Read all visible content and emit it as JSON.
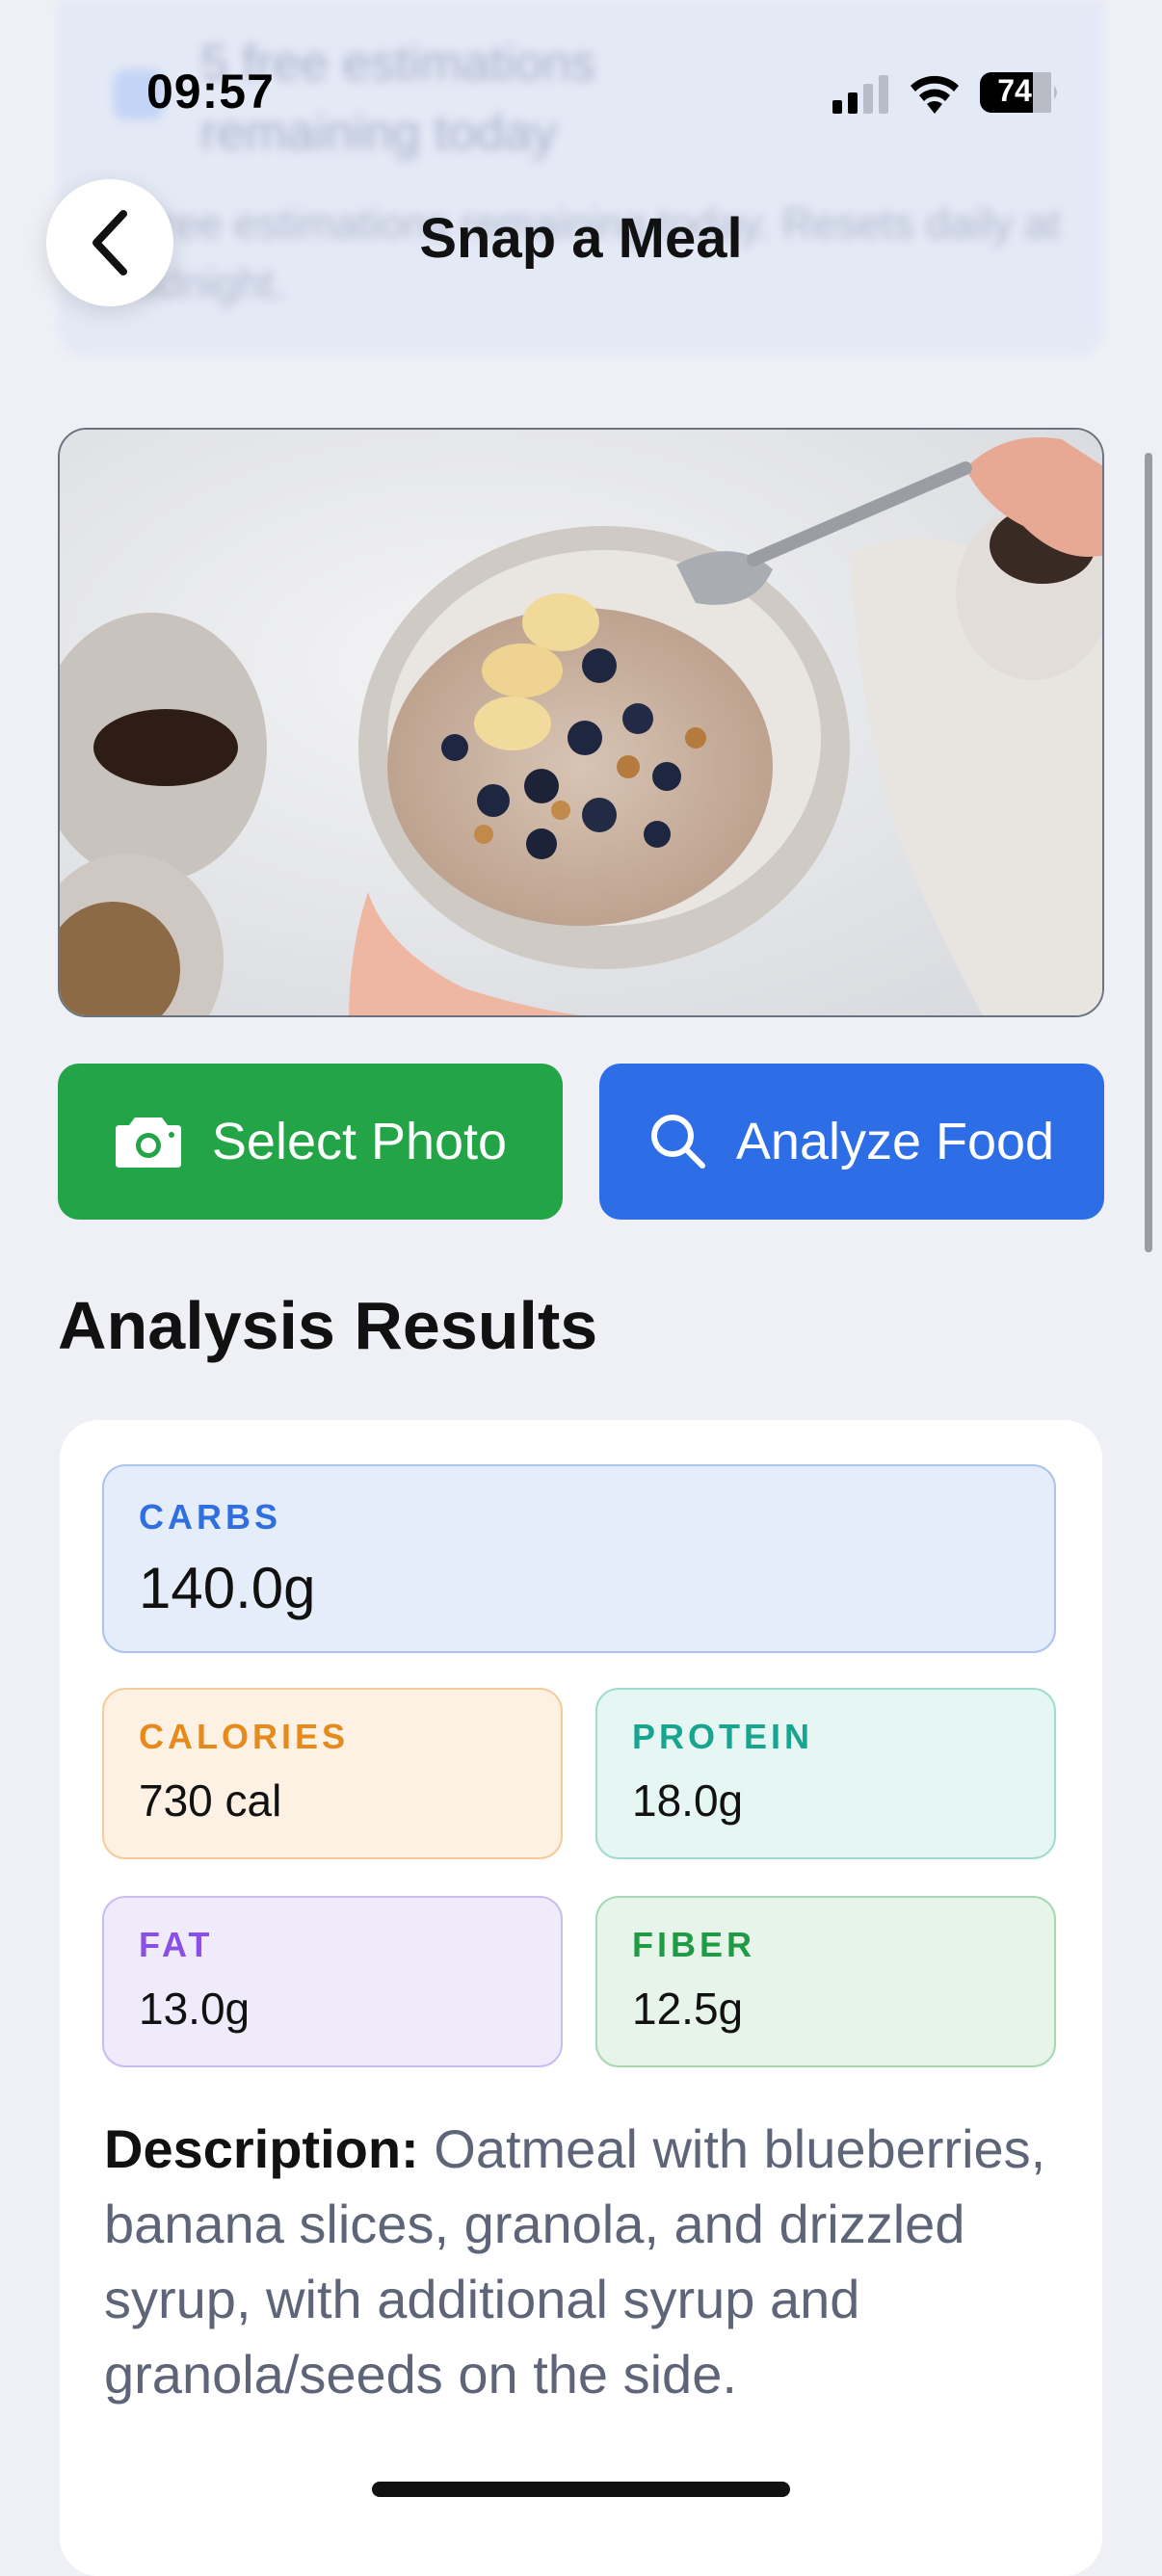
{
  "banner": {
    "title": "5 free estimations remaining today",
    "subtitle": "5 free estimations remaining today. Resets daily at midnight."
  },
  "status_bar": {
    "time": "09:57",
    "battery": "74"
  },
  "nav": {
    "title": "Snap a Meal"
  },
  "actions": {
    "select_photo_label": "Select Photo",
    "analyze_food_label": "Analyze Food"
  },
  "results": {
    "section_title": "Analysis Results",
    "carbs": {
      "label": "CARBS",
      "value": "140.0g"
    },
    "calories": {
      "label": "CALORIES",
      "value": "730 cal"
    },
    "protein": {
      "label": "PROTEIN",
      "value": "18.0g"
    },
    "fat": {
      "label": "FAT",
      "value": "13.0g"
    },
    "fiber": {
      "label": "FIBER",
      "value": "12.5g"
    },
    "description_label": "Description:",
    "description_text": "Oatmeal with blueberries, banana slices, granola, and drizzled syrup, with additional syrup and granola/seeds on the side."
  },
  "colors": {
    "select_button": "#22a447",
    "analyze_button": "#2d6ee6",
    "carbs_accent": "#2f6fe0",
    "calories_accent": "#e58a1c",
    "protein_accent": "#18a58f",
    "fat_accent": "#8a4fe4",
    "fiber_accent": "#1f9a45"
  },
  "icons": {
    "back": "chevron-left-icon",
    "camera": "camera-icon",
    "search": "search-icon"
  }
}
